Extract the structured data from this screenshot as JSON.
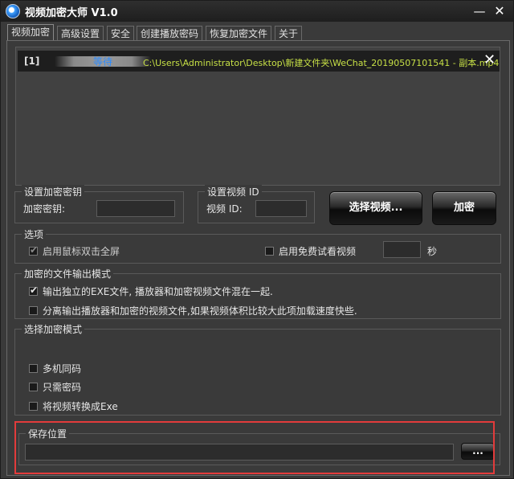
{
  "window": {
    "title": "视频加密大师 V1.0",
    "minimize": "—",
    "close": "✕"
  },
  "tabs": [
    {
      "label": "视频加密",
      "active": true
    },
    {
      "label": "高级设置"
    },
    {
      "label": "安全"
    },
    {
      "label": "创建播放密码"
    },
    {
      "label": "恢复加密文件"
    },
    {
      "label": "关于"
    }
  ],
  "file_list": [
    {
      "index": "[1]",
      "status": "等待",
      "path": "C:\\Users\\Administrator\\Desktop\\新建文件夹\\WeChat_20190507101541 - 副本.mp4",
      "remove": "✕"
    }
  ],
  "encrypt_key": {
    "group_title": "设置加密密钥",
    "label": "加密密钥:",
    "value": ""
  },
  "video_id": {
    "group_title": "设置视频 ID",
    "label": "视频 ID:",
    "value": ""
  },
  "buttons": {
    "select_video": "选择视频...",
    "encrypt": "加密",
    "browse": "..."
  },
  "options": {
    "group_title": "选项",
    "fullscreen": {
      "label": "启用鼠标双击全屏",
      "checked": true,
      "disabled": true
    },
    "free_trial": {
      "label": "启用免费试看视频",
      "checked": false
    },
    "trial_seconds": "",
    "seconds_unit": "秒"
  },
  "output_mode": {
    "group_title": "加密的文件输出模式",
    "items": [
      {
        "label": "输出独立的EXE文件, 播放器和加密视频文件混在一起.",
        "checked": true
      },
      {
        "label": "分离输出播放器和加密的视频文件,如果视频体积比较大此项加载速度快些.",
        "checked": false
      }
    ]
  },
  "encrypt_mode": {
    "group_title": "选择加密模式",
    "items": [
      {
        "label": "多机同码",
        "checked": false
      },
      {
        "label": "只需密码",
        "checked": false
      },
      {
        "label": "将视频转换成Exe",
        "checked": false
      }
    ]
  },
  "save_location": {
    "group_title": "保存位置",
    "path": ""
  },
  "colors": {
    "path_text": "#c7e046",
    "status_text": "#2d8cff",
    "highlight_border": "#e23b3b"
  }
}
